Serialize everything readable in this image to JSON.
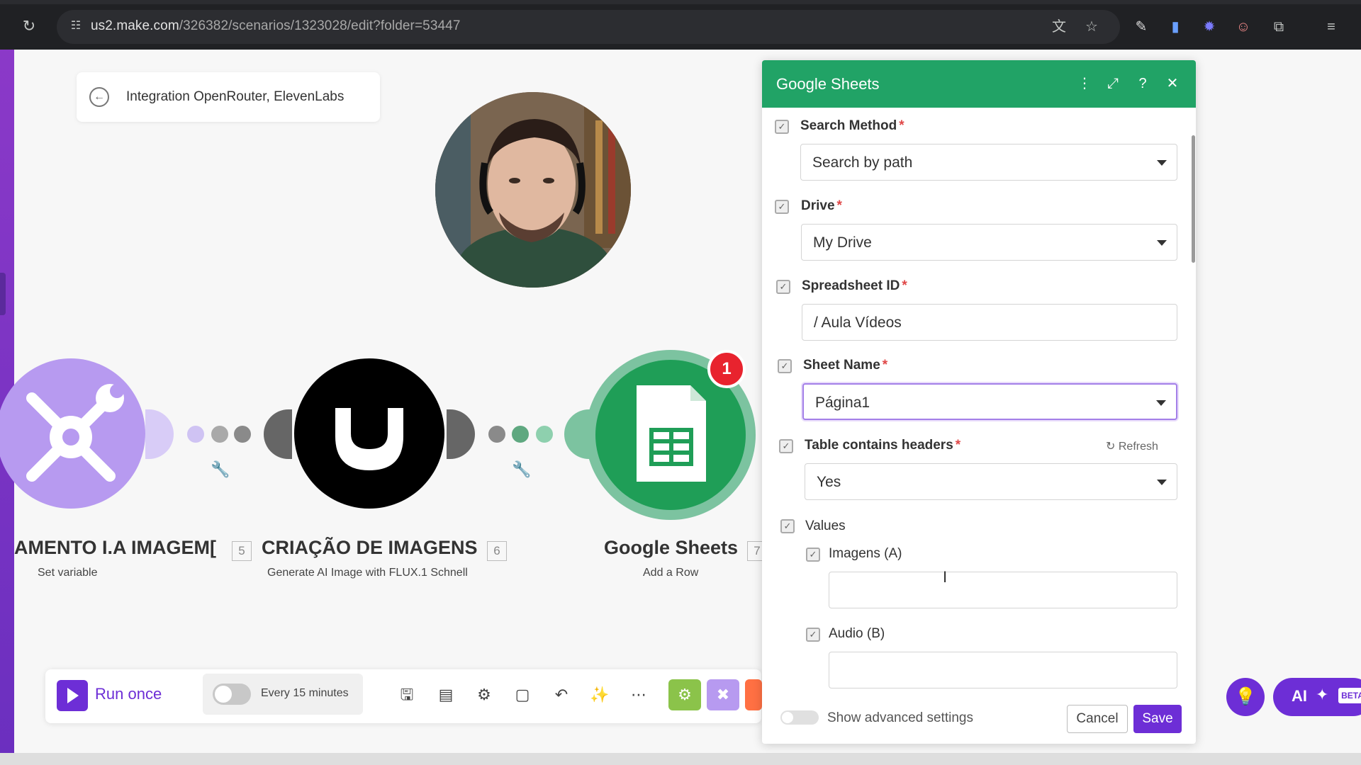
{
  "browser": {
    "url_host": "us2.make.com",
    "url_path": "/326382/scenarios/1323028/edit?folder=53447"
  },
  "scenario": {
    "back_label": "Integration OpenRouter, ElevenLabs"
  },
  "modules": [
    {
      "title": "AMENTO I.A IMAGEM[",
      "number": "5",
      "subtitle": "Set variable",
      "color": "#b79af0"
    },
    {
      "title": "CRIAÇÃO DE IMAGENS",
      "number": "6",
      "subtitle": "Generate AI Image with FLUX.1 Schnell",
      "color": "#000000"
    },
    {
      "title": "Google Sheets",
      "number": "7",
      "subtitle": "Add a Row",
      "color": "#1f9e57",
      "badge": "1"
    }
  ],
  "toolbar": {
    "run_label": "Run once",
    "schedule_label": "Every 15 minutes",
    "ai_label": "AI",
    "beta_label": "BETA"
  },
  "panel": {
    "title": "Google Sheets",
    "header_color": "#21a366",
    "fields": {
      "search_method": {
        "label": "Search Method",
        "value": "Search by path"
      },
      "drive": {
        "label": "Drive",
        "value": "My Drive"
      },
      "spreadsheet_id": {
        "label": "Spreadsheet ID",
        "value": "/ Aula Vídeos"
      },
      "sheet_name": {
        "label": "Sheet Name",
        "value": "Página1"
      },
      "table_headers": {
        "label": "Table contains headers",
        "value": "Yes",
        "refresh_label": "Refresh"
      },
      "values": {
        "label": "Values"
      },
      "col_a": {
        "label": "Imagens (A)",
        "value": ""
      },
      "col_b": {
        "label": "Audio (B)",
        "value": ""
      }
    },
    "advanced_label": "Show advanced settings",
    "cancel_label": "Cancel",
    "save_label": "Save",
    "required_mark": "*"
  },
  "icons": {
    "reload": "reload-icon",
    "translate": "translate-icon",
    "bookmark": "star-icon"
  },
  "accent_color": "#6d2ed6"
}
